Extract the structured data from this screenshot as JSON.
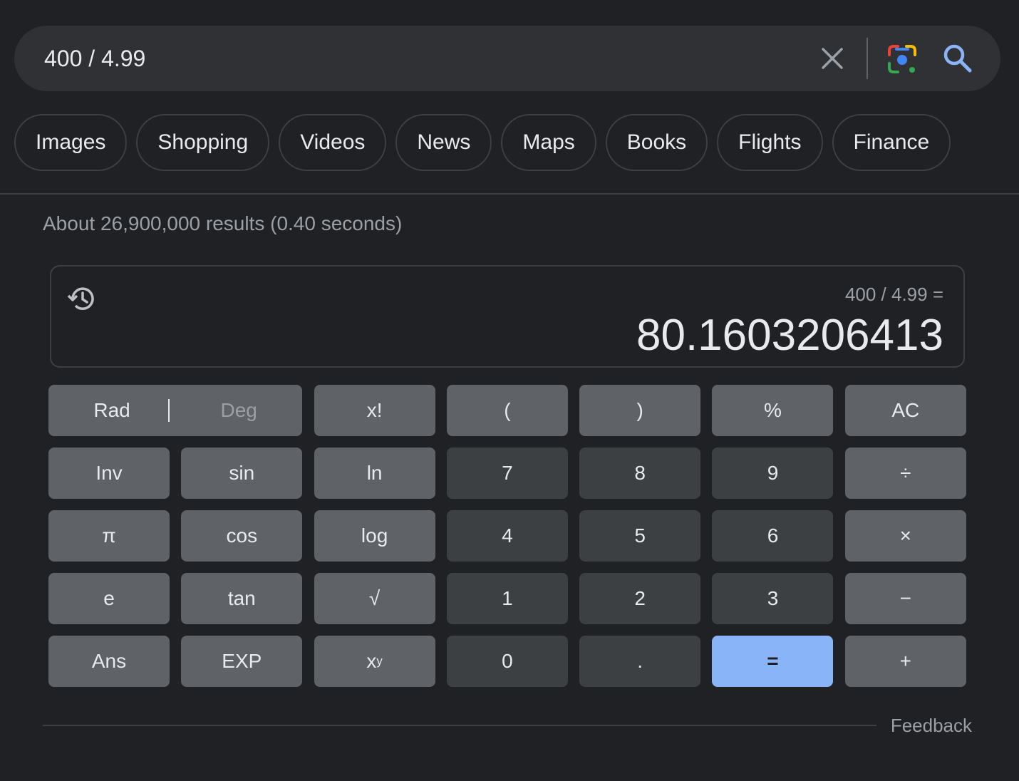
{
  "search": {
    "query": "400 / 4.99",
    "clear_icon": "close-icon",
    "lens_icon": "google-lens-icon",
    "search_icon": "search-icon"
  },
  "chips": [
    "Images",
    "Shopping",
    "Videos",
    "News",
    "Maps",
    "Books",
    "Flights",
    "Finance"
  ],
  "results": {
    "stats": "About 26,900,000 results (0.40 seconds)"
  },
  "calculator": {
    "history_icon": "history-icon",
    "expression": "400 / 4.99 =",
    "result": "80.1603206413",
    "keys": {
      "rad": "Rad",
      "deg": "Deg",
      "fact": "x!",
      "lparen": "(",
      "rparen": ")",
      "percent": "%",
      "ac": "AC",
      "inv": "Inv",
      "sin": "sin",
      "ln": "ln",
      "k7": "7",
      "k8": "8",
      "k9": "9",
      "div": "÷",
      "pi": "π",
      "cos": "cos",
      "log": "log",
      "k4": "4",
      "k5": "5",
      "k6": "6",
      "mul": "×",
      "e": "e",
      "tan": "tan",
      "sqrt": "√",
      "k1": "1",
      "k2": "2",
      "k3": "3",
      "sub": "−",
      "ans": "Ans",
      "exp": "EXP",
      "pow_base": "x",
      "pow_sup": "y",
      "k0": "0",
      "dot": ".",
      "eq": "=",
      "add": "+"
    },
    "feedback": "Feedback",
    "colors": {
      "equals_key": "#8ab4f8",
      "func_key": "#5f6368",
      "num_key": "#3c4043"
    }
  }
}
